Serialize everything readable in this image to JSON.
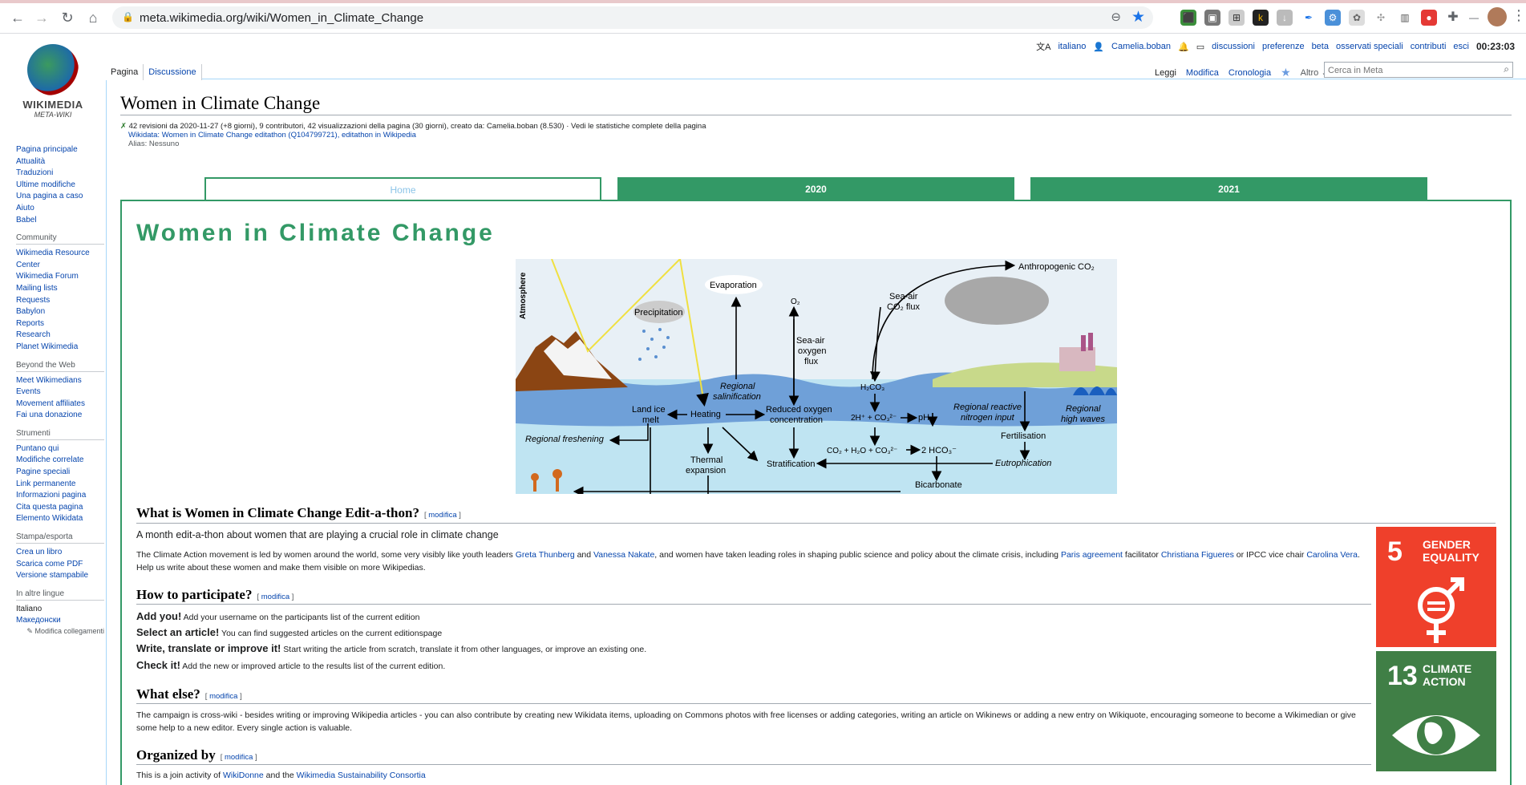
{
  "browser": {
    "url": "meta.wikimedia.org/wiki/Women_in_Climate_Change",
    "colors": {
      "accent": "#1a73e8"
    }
  },
  "personal_tools": {
    "language": "italiano",
    "user": "Camelia.boban",
    "links": [
      "discussioni",
      "preferenze",
      "beta",
      "osservati speciali",
      "contributi",
      "esci"
    ],
    "clock": "00:23:03"
  },
  "logo": {
    "line1": "WIKIMEDIA",
    "line2": "META-WIKI"
  },
  "sidebar": {
    "nav": [
      "Pagina principale",
      "Attualità",
      "Traduzioni",
      "Ultime modifiche",
      "Una pagina a caso",
      "Aiuto",
      "Babel"
    ],
    "community_title": "Community",
    "community": [
      "Wikimedia Resource Center",
      "Wikimedia Forum",
      "Mailing lists",
      "Requests",
      "Babylon",
      "Reports",
      "Research",
      "Planet Wikimedia"
    ],
    "web_title": "Beyond the Web",
    "web": [
      "Meet Wikimedians",
      "Events",
      "Movement affiliates",
      "Fai una donazione"
    ],
    "tools_title": "Strumenti",
    "tools": [
      "Puntano qui",
      "Modifiche correlate",
      "Pagine speciali",
      "Link permanente",
      "Informazioni pagina",
      "Cita questa pagina",
      "Elemento Wikidata"
    ],
    "print_title": "Stampa/esporta",
    "print": [
      "Crea un libro",
      "Scarica come PDF",
      "Versione stampabile"
    ],
    "lang_title": "In altre lingue",
    "langs": [
      "Italiano",
      "Македонски"
    ],
    "edit_links": "Modifica collegamenti"
  },
  "page_tabs": {
    "page": "Pagina",
    "talk": "Discussione",
    "read": "Leggi",
    "edit": "Modifica",
    "history": "Cronologia",
    "more": "Altro"
  },
  "search": {
    "placeholder": "Cerca in Meta"
  },
  "page": {
    "title": "Women in Climate Change",
    "info_line1": "42 revisioni da 2020-11-27 (+8 giorni), 9 contributori, 42 visualizzazioni della pagina (30 giorni), creato da: Camelia.boban (8.530) · Vedi le statistiche complete della pagina",
    "info_line2": "Wikidata: Women in Climate Change editathon (Q104799721), editathon in Wikipedia",
    "info_line3": "Alias: Nessuno"
  },
  "green_tabs": {
    "home": "Home",
    "y2020": "2020",
    "y2021": "2021"
  },
  "banner_title": "Women in Climate Change",
  "diagram_labels": {
    "atmosphere": "Atmosphere",
    "evaporation": "Evaporation",
    "anthropogenic": "Anthropogenic CO₂",
    "precipitation": "Precipitation",
    "o2": "O₂",
    "seaair_co2_1": "Sea-air",
    "seaair_co2_2": "CO₂ flux",
    "seaair_o2_1": "Sea-air",
    "seaair_o2_2": "oxygen",
    "seaair_o2_3": "flux",
    "regsal1": "Regional",
    "regsal2": "salinification",
    "h2co3": "H₂CO₃",
    "landice1": "Land ice",
    "landice2": "melt",
    "heating": "Heating",
    "redox1": "Reduced oxygen",
    "redox2": "concentration",
    "hco": "2H⁺ + CO₃²⁻",
    "ph": "pH",
    "regreact1": "Regional reactive",
    "regreact2": "nitrogen input",
    "reghigh1": "Regional",
    "reghigh2": "high waves",
    "regfresh": "Regional freshening",
    "fert": "Fertilisation",
    "co2eq": "CO₂ + H₂O + CO₃²⁻",
    "hco3": "2 HCO₃⁻",
    "thermal1": "Thermal",
    "thermal2": "expansion",
    "strat": "Stratification",
    "eutro": "Eutrophication",
    "bicarb": "Bicarbonate"
  },
  "sections": {
    "what_title": "What is Women in Climate Change Edit-a-thon?",
    "edit": "modifica",
    "what_lead": "A month edit-a-thon about women that are playing a crucial role in climate change",
    "what_p_a": "The Climate Action movement is led by women around the world, some very visibly like youth leaders ",
    "what_l1": "Greta Thunberg",
    "what_p_b": " and ",
    "what_l2": "Vanessa Nakate",
    "what_p_c": ", and women have taken leading roles in shaping public science and policy about the climate crisis, including ",
    "what_l3": "Paris agreement",
    "what_p_d": " facilitator ",
    "what_l4": "Christiana Figueres",
    "what_p_e": " or IPCC vice chair ",
    "what_l5": "Carolina Vera",
    "what_p_f": ".",
    "what_p2": "Help us write about these women and make them visible on more Wikipedias.",
    "how_title": "How to participate?",
    "steps": [
      {
        "b": "Add you!",
        "t": " Add your username on the participants list of the current edition"
      },
      {
        "b": "Select an article!",
        "t": " You can find suggested articles on the current editionspage"
      },
      {
        "b": "Write, translate or improve it!",
        "t": " Start writing the article from scratch, translate it from other languages, or improve an existing one."
      },
      {
        "b": "Check it!",
        "t": " Add the new or improved article to the results list of the current edition."
      }
    ],
    "else_title": "What else?",
    "else_p": "The campaign is cross-wiki - besides writing or improving Wikipedia articles - you can also contribute by creating new Wikidata items, uploading on Commons photos with free licenses or adding categories, writing an article on Wikinews or adding a new entry on Wikiquote, encouraging someone to become a Wikimedian or give",
    "else_p2": "some help to a new editor. Every single action is valuable.",
    "org_title": "Organized by",
    "org_a": "This is a join activity of ",
    "org_l1": "WikiDonne",
    "org_b": " and the ",
    "org_l2": "Wikimedia Sustainability Consortia"
  },
  "sdg": [
    {
      "num": "5",
      "l1": "GENDER",
      "l2": "EQUALITY",
      "color": "#ef402b"
    },
    {
      "num": "13",
      "l1": "CLIMATE",
      "l2": "ACTION",
      "color": "#407f46"
    }
  ]
}
